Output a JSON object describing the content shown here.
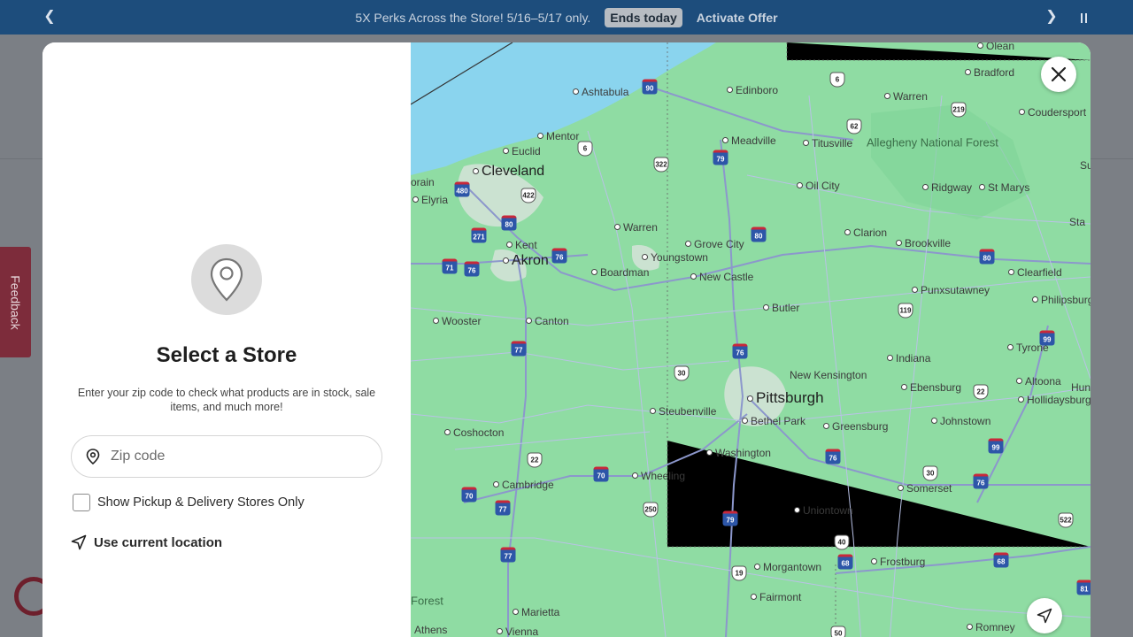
{
  "promo": {
    "message": "5X Perks Across the Store! 5/16–5/17 only.",
    "badge": "Ends today",
    "offer_link": "Activate Offer"
  },
  "feedback_tab": "Feedback",
  "store_modal": {
    "title": "Select a Store",
    "subtitle": "Enter your zip code to check what products are in stock, sale items, and much more!",
    "zip_placeholder": "Zip code",
    "zip_value": "",
    "pickup_checkbox_label": "Show Pickup & Delivery Stores Only",
    "pickup_checked": false,
    "use_location_label": "Use current location"
  },
  "map": {
    "places": [
      {
        "name": "Olean",
        "kind": "dot"
      },
      {
        "name": "Bradford",
        "kind": "dot"
      },
      {
        "name": "Ashtabula",
        "kind": "dot"
      },
      {
        "name": "Edinboro",
        "kind": "dot"
      },
      {
        "name": "Warren",
        "kind": "dot"
      },
      {
        "name": "Coudersport",
        "kind": "dot"
      },
      {
        "name": "Mentor",
        "kind": "dot"
      },
      {
        "name": "Meadville",
        "kind": "dot"
      },
      {
        "name": "Titusville",
        "kind": "dot"
      },
      {
        "name": "Allegheny National Forest",
        "kind": "forest"
      },
      {
        "name": "Euclid",
        "kind": "dot"
      },
      {
        "name": "Cleveland",
        "kind": "city"
      },
      {
        "name": "Oil City",
        "kind": "dot"
      },
      {
        "name": "Ridgway",
        "kind": "dot"
      },
      {
        "name": "St Marys",
        "kind": "dot"
      },
      {
        "name": "Elyria",
        "kind": "dot"
      },
      {
        "name": "Warren",
        "kind": "dot"
      },
      {
        "name": "Kent",
        "kind": "dot"
      },
      {
        "name": "Grove City",
        "kind": "dot"
      },
      {
        "name": "Clarion",
        "kind": "dot"
      },
      {
        "name": "Brookville",
        "kind": "dot"
      },
      {
        "name": "Akron",
        "kind": "city"
      },
      {
        "name": "Youngstown",
        "kind": "dot"
      },
      {
        "name": "Boardman",
        "kind": "dot"
      },
      {
        "name": "New Castle",
        "kind": "dot"
      },
      {
        "name": "Clearfield",
        "kind": "dot"
      },
      {
        "name": "Punxsutawney",
        "kind": "dot"
      },
      {
        "name": "Philipsburg",
        "kind": "dot"
      },
      {
        "name": "Wooster",
        "kind": "dot"
      },
      {
        "name": "Canton",
        "kind": "dot"
      },
      {
        "name": "Butler",
        "kind": "dot"
      },
      {
        "name": "Tyrone",
        "kind": "dot"
      },
      {
        "name": "New Kensington",
        "kind": "dot"
      },
      {
        "name": "Indiana",
        "kind": "dot"
      },
      {
        "name": "Altoona",
        "kind": "dot"
      },
      {
        "name": "Pittsburgh",
        "kind": "big"
      },
      {
        "name": "Ebensburg",
        "kind": "dot"
      },
      {
        "name": "Hollidaysburg",
        "kind": "dot"
      },
      {
        "name": "Steubenville",
        "kind": "dot"
      },
      {
        "name": "Bethel Park",
        "kind": "dot"
      },
      {
        "name": "Greensburg",
        "kind": "dot"
      },
      {
        "name": "Johnstown",
        "kind": "dot"
      },
      {
        "name": "Coshocton",
        "kind": "dot"
      },
      {
        "name": "Washington",
        "kind": "dot"
      },
      {
        "name": "Wheeling",
        "kind": "dot"
      },
      {
        "name": "Cambridge",
        "kind": "dot"
      },
      {
        "name": "Somerset",
        "kind": "dot"
      },
      {
        "name": "Uniontown",
        "kind": "dot"
      },
      {
        "name": "Frostburg",
        "kind": "dot"
      },
      {
        "name": "Morgantown",
        "kind": "dot"
      },
      {
        "name": "Fairmont",
        "kind": "dot"
      },
      {
        "name": "Marietta",
        "kind": "dot"
      },
      {
        "name": "Vienna",
        "kind": "dot"
      },
      {
        "name": "Athens",
        "kind": "dot"
      },
      {
        "name": "Romney",
        "kind": "dot"
      }
    ],
    "shields": [
      {
        "label": "90",
        "kind": "i"
      },
      {
        "label": "6",
        "kind": "us"
      },
      {
        "label": "219",
        "kind": "us"
      },
      {
        "label": "62",
        "kind": "us"
      },
      {
        "label": "6",
        "kind": "us"
      },
      {
        "label": "322",
        "kind": "us"
      },
      {
        "label": "79",
        "kind": "i"
      },
      {
        "label": "480",
        "kind": "i"
      },
      {
        "label": "422",
        "kind": "us"
      },
      {
        "label": "80",
        "kind": "i"
      },
      {
        "label": "271",
        "kind": "i"
      },
      {
        "label": "80",
        "kind": "i"
      },
      {
        "label": "76",
        "kind": "i"
      },
      {
        "label": "71",
        "kind": "i"
      },
      {
        "label": "76",
        "kind": "i"
      },
      {
        "label": "80",
        "kind": "i"
      },
      {
        "label": "119",
        "kind": "us"
      },
      {
        "label": "99",
        "kind": "i"
      },
      {
        "label": "77",
        "kind": "i"
      },
      {
        "label": "76",
        "kind": "i"
      },
      {
        "label": "30",
        "kind": "us"
      },
      {
        "label": "22",
        "kind": "us"
      },
      {
        "label": "99",
        "kind": "i"
      },
      {
        "label": "22",
        "kind": "us"
      },
      {
        "label": "70",
        "kind": "i"
      },
      {
        "label": "76",
        "kind": "i"
      },
      {
        "label": "30",
        "kind": "us"
      },
      {
        "label": "76",
        "kind": "i"
      },
      {
        "label": "70",
        "kind": "i"
      },
      {
        "label": "77",
        "kind": "i"
      },
      {
        "label": "250",
        "kind": "us"
      },
      {
        "label": "79",
        "kind": "i"
      },
      {
        "label": "522",
        "kind": "us"
      },
      {
        "label": "40",
        "kind": "us"
      },
      {
        "label": "68",
        "kind": "i"
      },
      {
        "label": "68",
        "kind": "i"
      },
      {
        "label": "77",
        "kind": "i"
      },
      {
        "label": "19",
        "kind": "us"
      },
      {
        "label": "81",
        "kind": "i"
      },
      {
        "label": "50",
        "kind": "us"
      }
    ],
    "partial_labels": [
      "Forest",
      "Sta",
      "Su",
      "orain",
      "Hun"
    ]
  }
}
